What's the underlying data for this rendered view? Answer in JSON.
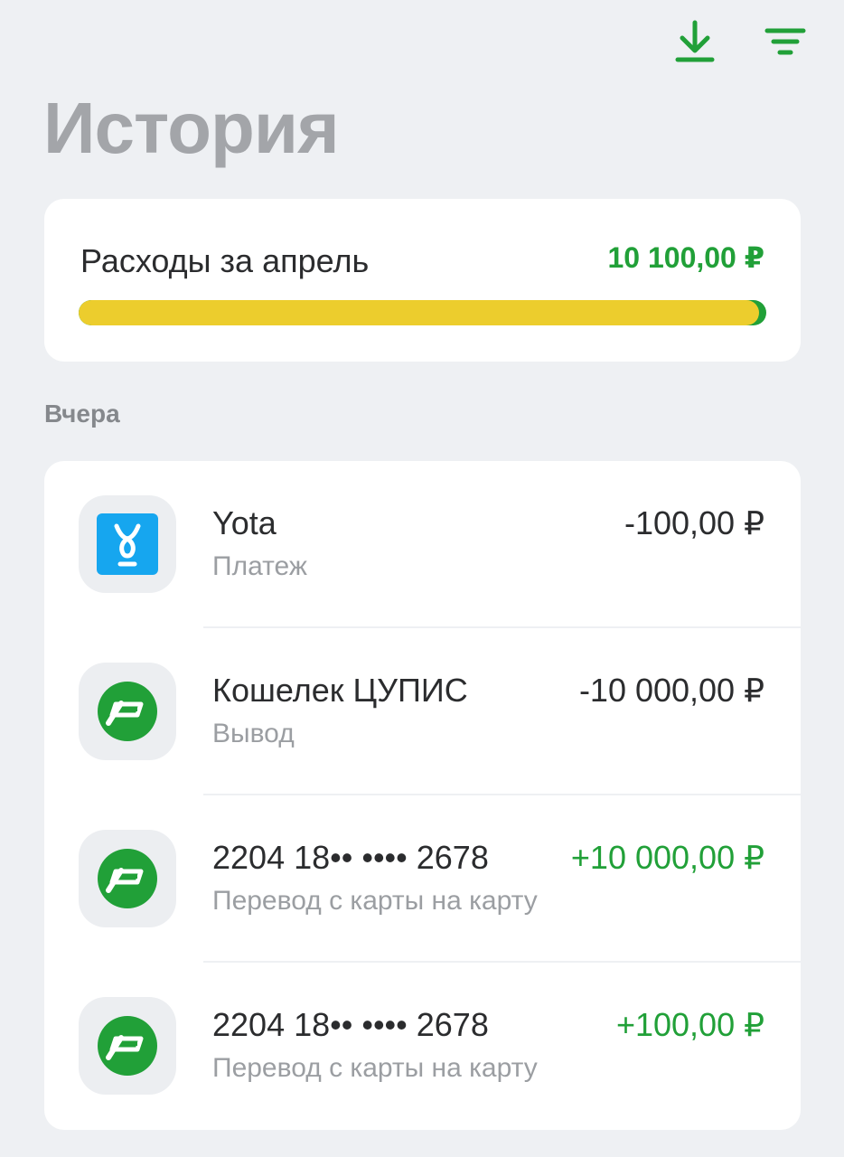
{
  "header": {
    "title": "История",
    "download_icon": "download-icon",
    "filter_icon": "filter-icon",
    "accent_color": "#21a038"
  },
  "summary": {
    "label": "Расходы за апрель",
    "amount": "10 100,00 ₽",
    "progress_fraction": 0.99,
    "progress_color": "#eccd2d"
  },
  "section": {
    "label": "Вчера"
  },
  "transactions": [
    {
      "name": "Yota",
      "subtitle": "Платеж",
      "amount": "-100,00 ₽",
      "positive": false,
      "icon": "yota-logo-icon"
    },
    {
      "name": "Кошелек ЦУПИС",
      "subtitle": "Вывод",
      "amount": "-10 000,00 ₽",
      "positive": false,
      "icon": "sber-logo-icon"
    },
    {
      "name": "2204 18•• •••• 2678",
      "subtitle": "Перевод с карты на карту",
      "amount": "+10 000,00 ₽",
      "positive": true,
      "icon": "sber-logo-icon"
    },
    {
      "name": "2204 18•• •••• 2678",
      "subtitle": "Перевод с карты на карту",
      "amount": "+100,00 ₽",
      "positive": true,
      "icon": "sber-logo-icon"
    }
  ]
}
